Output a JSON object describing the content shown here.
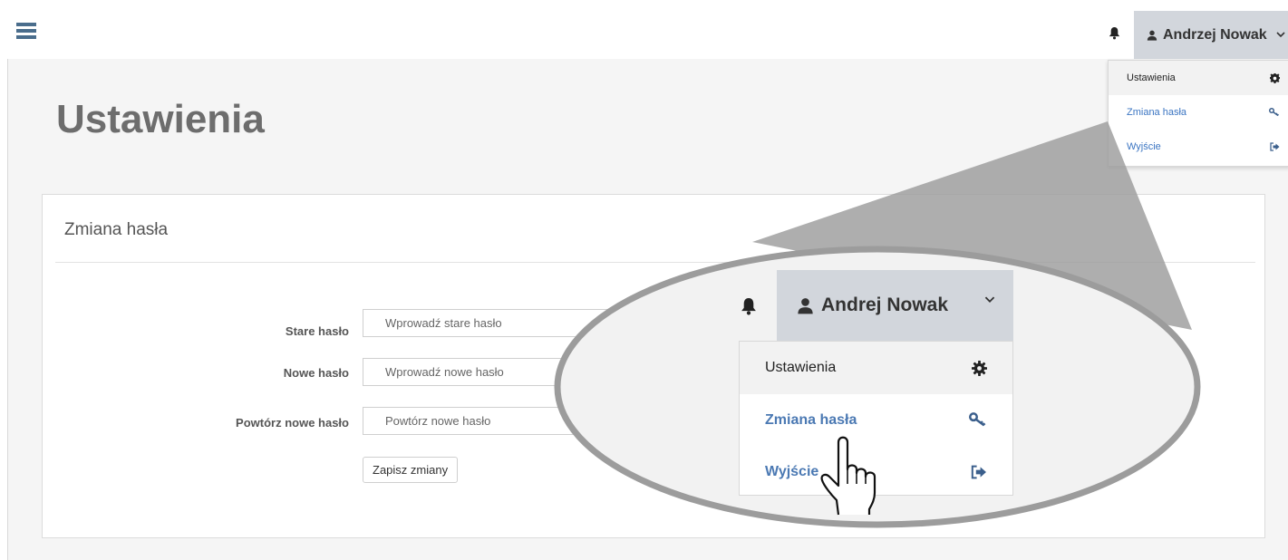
{
  "header": {
    "menu_icon": "hamburger-icon",
    "bell_icon": "bell-icon",
    "user_icon": "user-icon",
    "user_name": "Andrzej Nowak",
    "chevron_icon": "chevron-down-icon"
  },
  "user_menu": {
    "items": [
      {
        "label": "Ustawienia",
        "icon": "gear-icon"
      },
      {
        "label": "Zmiana hasła",
        "icon": "key-icon"
      },
      {
        "label": "Wyjście",
        "icon": "logout-icon"
      }
    ]
  },
  "page": {
    "title": "Ustawienia"
  },
  "password_panel": {
    "title": "Zmiana hasła",
    "fields": [
      {
        "label": "Stare hasło",
        "placeholder": "Wprowadź stare hasło"
      },
      {
        "label": "Nowe hasło",
        "placeholder": "Wprowadź nowe hasło"
      },
      {
        "label": "Powtórz nowe hasło",
        "placeholder": "Powtórz nowe hasło"
      }
    ],
    "save_label": "Zapisz zmiany"
  },
  "zoom_callout": {
    "user_name": "Andrej Nowak",
    "items": [
      {
        "label": "Ustawienia",
        "icon": "gear-icon"
      },
      {
        "label": "Zmiana hasła",
        "icon": "key-icon"
      },
      {
        "label": "Wyjście",
        "icon": "logout-icon"
      }
    ],
    "pointer_icon": "hand-pointer-icon"
  },
  "colors": {
    "accent": "#3b75c2",
    "user_button_bg": "#d2d6dc",
    "title_gray": "#6d6d6d",
    "callout_gray": "#9a9a9a"
  }
}
